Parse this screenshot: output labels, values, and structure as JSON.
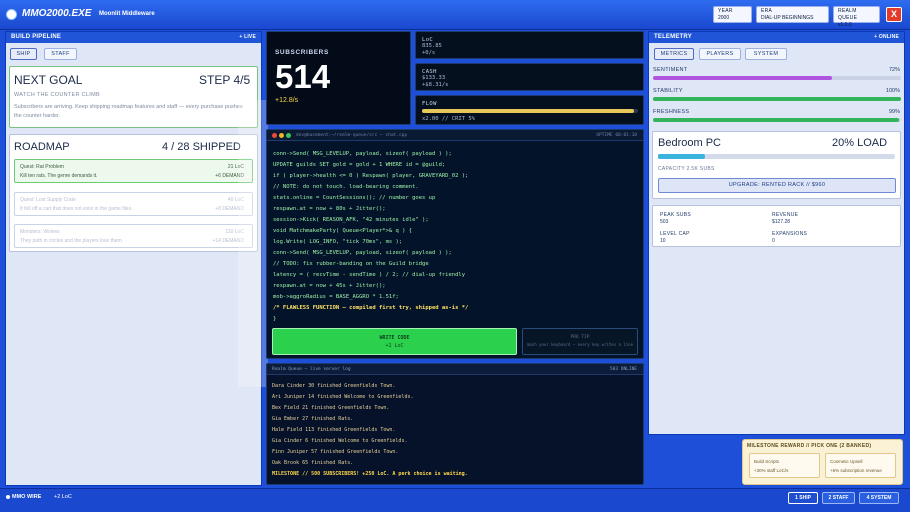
{
  "title_bar": {
    "app_title": "MMO2000.EXE",
    "subtitle": "Moonlit Middleware",
    "stats": [
      {
        "label": "YEAR",
        "value": "2000"
      },
      {
        "label": "ERA",
        "value": "DIAL-UP BEGINNINGS"
      },
      {
        "label": "REALM QUEUE",
        "value": "v1.0.0"
      }
    ],
    "close_label": "X"
  },
  "build_pipeline": {
    "title": "BUILD PIPELINE",
    "status": "+ LIVE",
    "tabs": [
      "SHIP",
      "STAFF"
    ],
    "next_goal": {
      "label": "NEXT GOAL",
      "step": "STEP 4/5",
      "headline": "WATCH THE COUNTER CLIMB",
      "description": "Subscribers are arriving. Keep shipping roadmap features and staff — every purchase pushes the counter harder."
    },
    "roadmap": {
      "label": "ROADMAP",
      "count": "4 / 28 SHIPPED",
      "items": [
        {
          "name": "Quest: Rat Problem",
          "desc": "Kill ten rats. The genre demands it.",
          "cost": "21 LoC",
          "demand": "+6 DEMAND"
        },
        {
          "name": "Quest: Lost Supply Crate",
          "desc": "It fell off a cart that does not exist in the game files.",
          "cost": "40 LoC",
          "demand": "+8 DEMAND"
        },
        {
          "name": "Monsters: Wolves",
          "desc": "They path in circles and the players love them.",
          "cost": "110 LoC",
          "demand": "+14 DEMAND"
        }
      ]
    }
  },
  "subscribers": {
    "label": "SUBSCRIBERS",
    "count": "514",
    "rate": "+12.8/s"
  },
  "mini_stats": {
    "loc": {
      "label": "LoC",
      "value": "835.85",
      "rate": "+0/s"
    },
    "cash": {
      "label": "CASH",
      "value": "$133.33",
      "rate": "+$8.31/s"
    },
    "flow": {
      "label": "FLOW",
      "detail": "x2.00 // CRIT 5%",
      "level": 0.98
    }
  },
  "editor": {
    "path": "dev@basement:~/realm-queue/src — chat.cpp",
    "meta": "UPTIME 00:01:10",
    "lines": [
      "conn->Send( MSG_LEVELUP, payload, sizeof( payload ) );",
      "UPDATE guilds SET gold = gold + 1 WHERE id = @guild;",
      "if ( player->health <= 0 ) Respawn( player, GRAVEYARD_02 );",
      "// NOTE: do not touch. load-bearing comment.",
      "stats.online = CountSessions(); // number goes up",
      "respawn.at = now + 80s + Jitter();",
      "session->Kick( REASON_AFK, \"42 minutes idle\" );",
      "void MatchmakeParty( Queue<Player*>& q ) {",
      "log.Write( LOG_INFO, \"tick 70ms\", ms );",
      "conn->Send( MSG_LEVELUP, payload, sizeof( payload ) );",
      "// TODO: fix rubber-banding on the Guild bridge",
      "latency = ( recvTime - sendTime ) / 2; // dial-up friendly",
      "respawn.at = now + 45s + Jitter();",
      "mob->aggroRadius = BASE_AGGRO * 1.51f;",
      "/* FLAWLESS FUNCTION — compiled first try, shipped as-is */",
      "}"
    ],
    "write_button": {
      "label": "WRITE CODE",
      "sub": "+1 LoC"
    },
    "tip": {
      "label": "PRO TIP",
      "text": "mash your keyboard — every key writes a line"
    }
  },
  "server_log": {
    "title": "Realm Queue — live server log",
    "status": "503 ONLINE",
    "lines": [
      "Dara Cinder 30 finished Greenfields Town.",
      "Ari Juniper 14 finished Welcome to Greenfields.",
      "Bex Field 21 finished Greenfields Town.",
      "Gia Ember 27 finished Rats.",
      "Hale Field 113 finished Greenfields Town.",
      "Gia Cinder 6 finished Welcome to Greenfields.",
      "Finn Juniper 57 finished Greenfields Town.",
      "Oak Brook 65 finished Rats.",
      "MILESTONE // 500 SUBSCRIBERS! +250 LoC. A perk choice is waiting."
    ]
  },
  "telemetry": {
    "title": "TELEMETRY",
    "status": "+ ONLINE",
    "tabs": [
      "METRICS",
      "PLAYERS",
      "SYSTEM"
    ],
    "bars": [
      {
        "label": "SENTIMENT",
        "value": "72%",
        "level": 0.72,
        "color": "#b055e0"
      },
      {
        "label": "STABILITY",
        "value": "100%",
        "level": 1.0,
        "color": "#33b35a"
      },
      {
        "label": "FRESHNESS",
        "value": "99%",
        "level": 0.99,
        "color": "#33b35a"
      }
    ],
    "server": {
      "name": "Bedroom PC",
      "load": "20% LOAD",
      "load_level": 0.2,
      "capacity": "CAPACITY 2.5K SUBS",
      "upgrade": "UPGRADE: RENTED RACK // $960"
    },
    "stats": [
      {
        "label": "PEAK SUBS",
        "value": "503"
      },
      {
        "label": "REVENUE",
        "value": "$127.28"
      },
      {
        "label": "LEVEL CAP",
        "value": "10"
      },
      {
        "label": "EXPANSIONS",
        "value": "0"
      }
    ]
  },
  "milestone": {
    "title": "MILESTONE REWARD // PICK ONE (2 BANKED)",
    "options": [
      {
        "name": "Build Scripts",
        "desc": "+30% staff LoC/s"
      },
      {
        "name": "Cosmetic Upsell",
        "desc": "+6% subscription revenue"
      }
    ]
  },
  "status_bar": {
    "wire": "MMO WIRE",
    "wire_value": "+2 LoC",
    "buttons": [
      "1 SHIP",
      "2 STAFF",
      "4 SYSTEM"
    ]
  },
  "colors": {
    "accent": "#1f55d6",
    "code_green": "#9ef0a6",
    "button_green": "#2bd14d",
    "danger": "#e33b2a"
  }
}
